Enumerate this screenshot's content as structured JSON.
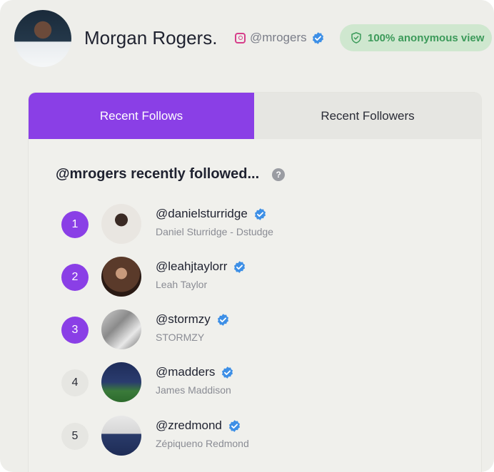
{
  "profile": {
    "name": "Morgan Rogers.",
    "handle": "@mrogers",
    "anon_badge": "100% anonymous view"
  },
  "tabs": [
    {
      "label": "Recent Follows",
      "active": true
    },
    {
      "label": "Recent Followers",
      "active": false
    }
  ],
  "section": {
    "title": "@mrogers recently followed...",
    "help": "?"
  },
  "follows": [
    {
      "rank": "1",
      "handle": "@danielsturridge",
      "name": "Daniel Sturridge - Dstudge",
      "verified": true
    },
    {
      "rank": "2",
      "handle": "@leahjtaylorr",
      "name": "Leah Taylor",
      "verified": true
    },
    {
      "rank": "3",
      "handle": "@stormzy",
      "name": "STORMZY",
      "verified": true
    },
    {
      "rank": "4",
      "handle": "@madders",
      "name": "James Maddison",
      "verified": true
    },
    {
      "rank": "5",
      "handle": "@zredmond",
      "name": "Zépiqueno Redmond",
      "verified": true
    }
  ],
  "colors": {
    "accent": "#8a3fe6",
    "verified": "#3d8fe6",
    "anon_badge_bg": "#cfe7cf",
    "anon_badge_text": "#3c9a5a",
    "instagram": "#d63d8a"
  }
}
